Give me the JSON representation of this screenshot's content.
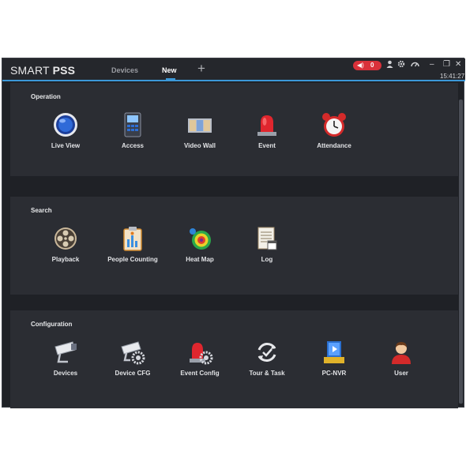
{
  "app": {
    "brand_light": "SMART ",
    "brand_bold": "PSS"
  },
  "tabs": {
    "devices": "Devices",
    "new": "New",
    "add": "+"
  },
  "titlebar": {
    "alarm_count": "0",
    "clock": "15:41:27",
    "icons": {
      "alarm": "bell-icon",
      "user": "user-icon",
      "settings": "gear-icon",
      "performance": "gauge-icon"
    },
    "window_controls": {
      "minimize": "–",
      "restore": "❐",
      "close": "✕"
    }
  },
  "colors": {
    "accent": "#3c98d8",
    "alarm": "#d9313a",
    "background": "#1f2126",
    "panel": "#2b2d33"
  },
  "sections": {
    "operation": {
      "title": "Operation",
      "items": [
        {
          "label": "Live View",
          "icon": "live-view-icon"
        },
        {
          "label": "Access",
          "icon": "access-icon"
        },
        {
          "label": "Video Wall",
          "icon": "video-wall-icon"
        },
        {
          "label": "Event",
          "icon": "event-icon"
        },
        {
          "label": "Attendance",
          "icon": "attendance-icon"
        }
      ]
    },
    "search": {
      "title": "Search",
      "items": [
        {
          "label": "Playback",
          "icon": "playback-icon"
        },
        {
          "label": "People Counting",
          "icon": "people-counting-icon"
        },
        {
          "label": "Heat Map",
          "icon": "heat-map-icon"
        },
        {
          "label": "Log",
          "icon": "log-icon"
        }
      ]
    },
    "configuration": {
      "title": "Configuration",
      "items": [
        {
          "label": "Devices",
          "icon": "devices-icon"
        },
        {
          "label": "Device CFG",
          "icon": "device-cfg-icon"
        },
        {
          "label": "Event Config",
          "icon": "event-config-icon"
        },
        {
          "label": "Tour & Task",
          "icon": "tour-task-icon"
        },
        {
          "label": "PC-NVR",
          "icon": "pc-nvr-icon"
        },
        {
          "label": "User",
          "icon": "user-account-icon"
        }
      ]
    }
  }
}
